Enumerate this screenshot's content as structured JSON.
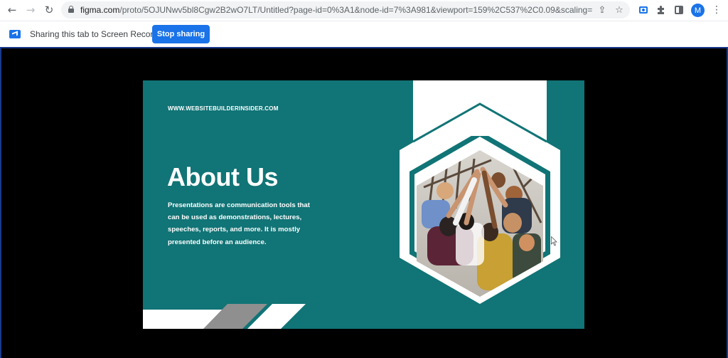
{
  "browser": {
    "url_main": "figma.com",
    "url_rest": "/proto/5OJUNwv5bl8Cgw2B2wO7LT/Untitled?page-id=0%3A1&node-id=7%3A981&viewport=159%2C537%2C0.09&scaling=contai...",
    "avatar_initial": "M"
  },
  "sharing": {
    "message": "Sharing this tab to Screen Recorder",
    "stop_label": "Stop sharing"
  },
  "slide": {
    "site": "WWW.WEBSITEBUILDERINSIDER.COM",
    "title": "About Us",
    "body": "Presentations are communication tools that can be used as demonstrations, lectures, speeches, reports, and more. It is mostly presented before an audience."
  },
  "colors": {
    "teal": "#117476",
    "accent_blue": "#1a73e8",
    "stripe_gray": "#8f8f8f"
  },
  "icons": {
    "back": "arrow-left-icon",
    "forward": "arrow-right-icon",
    "reload": "reload-icon",
    "lock": "lock-icon",
    "share": "share-icon",
    "star": "star-icon",
    "recorder": "screen-recorder-icon",
    "extensions": "puzzle-icon",
    "sidepanel": "side-panel-icon",
    "menu": "kebab-menu-icon"
  }
}
